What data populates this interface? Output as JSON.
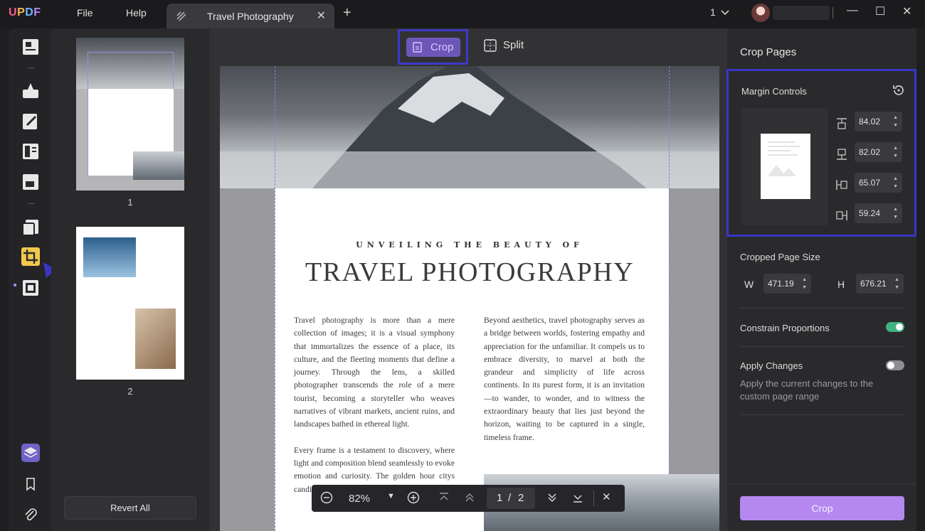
{
  "app": {
    "logo": "UPDF",
    "menu": [
      "File",
      "Help"
    ]
  },
  "tab": {
    "title": "Travel Photography"
  },
  "window": {
    "page_indicator": "1"
  },
  "left_toolbar": {
    "tools": [
      "reader-icon",
      "comment-icon",
      "edit-icon",
      "organize-icon",
      "form-icon",
      "convert-icon",
      "crop-icon",
      "compress-icon",
      "layers-icon",
      "bookmark-icon",
      "attachment-icon"
    ],
    "active": "crop-icon"
  },
  "thumbnails": {
    "pages": [
      "1",
      "2"
    ],
    "revert_label": "Revert All"
  },
  "modes": {
    "crop": "Crop",
    "split": "Split",
    "active": "Crop"
  },
  "document": {
    "subtitle": "UNVEILING THE BEAUTY OF",
    "title": "TRAVEL PHOTOGRAPHY",
    "col1_p1": "Travel photography is more than a mere collection of images; it is a visual symphony that immortalizes the essence of a place, its culture, and the fleeting moments that define a journey. Through the lens, a skilled photographer transcends the role of a mere tourist, becoming a storyteller who weaves narratives of vibrant markets, ancient ruins, and landscapes bathed in ethereal light.",
    "col1_p2": "Every frame is a testament to discovery, where light and composition blend seamlessly to evoke emotion and curiosity. The golden hour citys candid portraits breathes life into distant",
    "col2_p1": "Beyond aesthetics, travel photography serves as a bridge between worlds, fostering empathy and appreciation for the unfamiliar. It compels us to embrace diversity, to marvel at both the grandeur and simplicity of life across continents. In its purest form, it is an invitation—to wander, to wonder, and to witness the extraordinary beauty that lies just beyond the horizon, waiting to be captured in a single, timeless frame."
  },
  "zoom_bar": {
    "zoom": "82%",
    "current_page": "1",
    "separator": "/",
    "total_pages": "2"
  },
  "right_panel": {
    "title": "Crop Pages",
    "margin_controls": {
      "label": "Margin Controls",
      "top": "84.02",
      "bottom": "82.02",
      "left": "65.07",
      "right": "59.24"
    },
    "cropped_size": {
      "label": "Cropped Page Size",
      "w_label": "W",
      "w": "471.19",
      "h_label": "H",
      "h": "676.21"
    },
    "constrain": {
      "label": "Constrain Proportions",
      "on": true
    },
    "apply": {
      "label": "Apply Changes",
      "on": false,
      "hint": "Apply the current changes to the custom page range"
    },
    "crop_button": "Crop"
  },
  "colors": {
    "accent": "#b588f0",
    "highlight": "#3a36c4",
    "toggle_on": "#3fb27f",
    "crop_tool": "#f2c94c"
  }
}
